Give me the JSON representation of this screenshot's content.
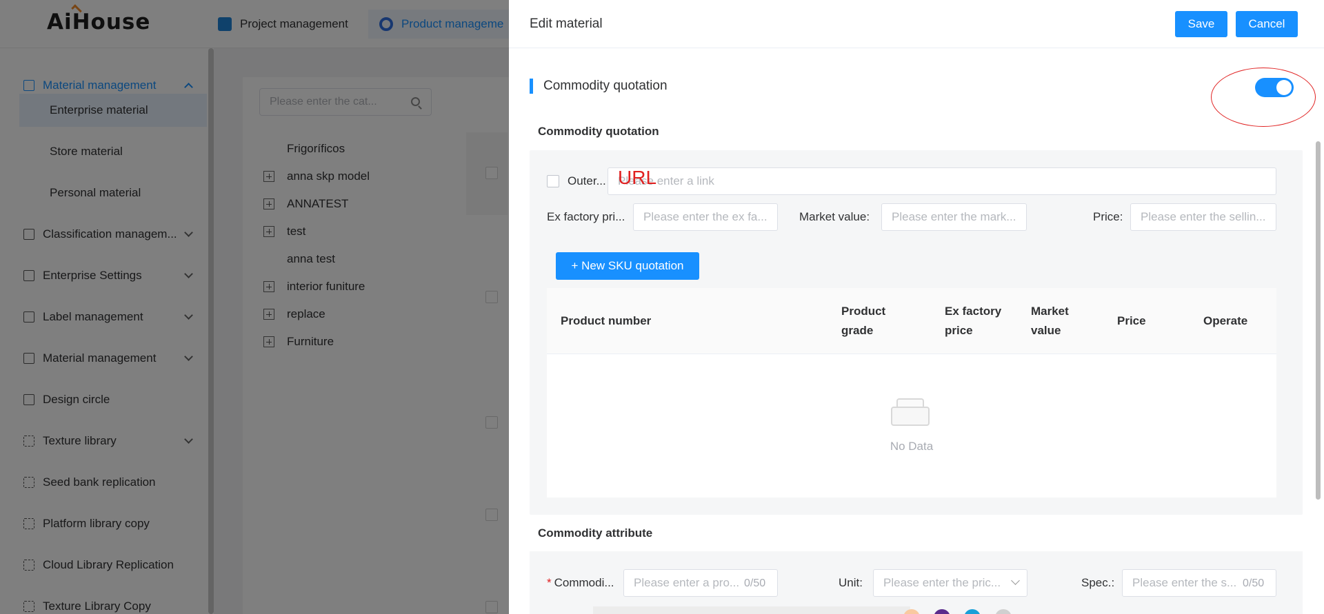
{
  "app": {
    "logo": "AiHouse",
    "topnav": [
      "Project management",
      "Product manageme"
    ]
  },
  "sidebar": {
    "items": [
      {
        "label": "Material management",
        "icon": "document-icon",
        "state": "expanded"
      },
      {
        "label": "Classification managem...",
        "icon": "list-icon"
      },
      {
        "label": "Enterprise Settings",
        "icon": "user-settings-icon"
      },
      {
        "label": "Label management",
        "icon": "label-icon"
      },
      {
        "label": "Material management",
        "icon": "calendar-icon"
      },
      {
        "label": "Design circle",
        "icon": "circle-icon"
      },
      {
        "label": "Texture library",
        "icon": "texture-icon"
      },
      {
        "label": "Seed bank replication",
        "icon": "copy-icon"
      },
      {
        "label": "Platform library copy",
        "icon": "copy-icon"
      },
      {
        "label": "Cloud Library Replication",
        "icon": "copy-icon"
      },
      {
        "label": "Texture Library Copy",
        "icon": "copy-icon"
      }
    ],
    "subitems": [
      "Enterprise material",
      "Store material",
      "Personal material"
    ],
    "selected_subitem": "Enterprise material"
  },
  "category": {
    "search_placeholder": "Please enter the cat...",
    "tree": [
      "Frigoríficos",
      "anna skp model",
      "ANNATEST",
      "test",
      "anna test",
      "interior funiture",
      "replace",
      "Furniture"
    ]
  },
  "drawer": {
    "title": "Edit material",
    "save": "Save",
    "cancel": "Cancel",
    "section_title": "Commodity quotation",
    "toggle_on": true,
    "quotation_subtitle": "Commodity quotation",
    "outer_label": "Outer...",
    "link_placeholder": "Please enter a link",
    "annotation_url": "URL",
    "ex_factory_label": "Ex factory pri...",
    "ex_factory_placeholder": "Please enter the ex fa...",
    "market_label": "Market value",
    "market_placeholder": "Please enter the mark...",
    "price_label": "Price",
    "price_placeholder": "Please enter the sellin...",
    "sku_button": "+ New SKU quotation",
    "table_headers": [
      "Product number",
      "Product grade",
      "Ex factory price",
      "Market value",
      "Price",
      "Operate"
    ],
    "empty_text": "No Data",
    "attribute_subtitle": "Commodity attribute",
    "commodity_label": "Commodi...",
    "commodity_placeholder": "Please enter a pro...",
    "commodity_counter": "0/50",
    "unit_label": "Unit",
    "unit_placeholder": "Please enter the pric...",
    "spec_label": "Spec.",
    "spec_placeholder": "Please enter the s...",
    "spec_counter": "0/50"
  },
  "colors": {
    "primary": "#1890ff",
    "annotation_red": "#e02020",
    "swatches": [
      "#f9c9a0",
      "#5a2b8c",
      "#1aa0d8",
      "#d0d0d0"
    ]
  }
}
